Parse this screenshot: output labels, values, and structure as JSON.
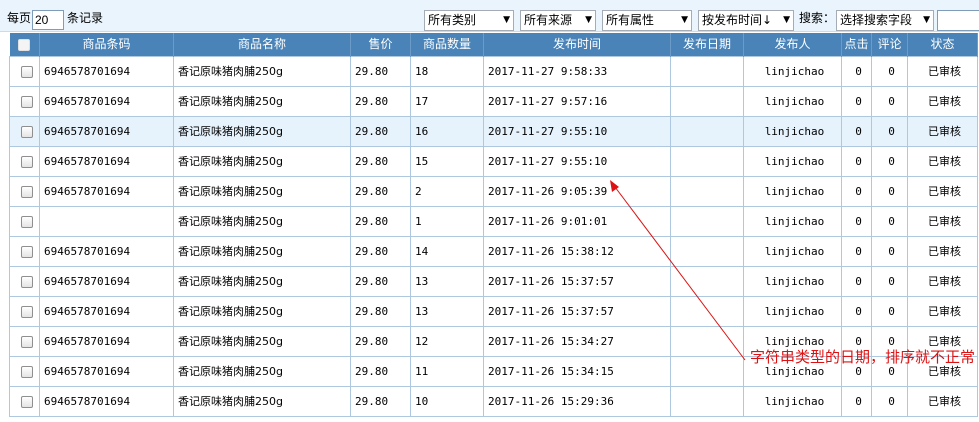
{
  "toolbar": {
    "per_page_label": "每页",
    "per_page_value": "20",
    "records_label": "条记录",
    "filters": [
      {
        "label": "所有类别"
      },
      {
        "label": "所有来源"
      },
      {
        "label": "所有属性"
      },
      {
        "label": "按发布时间↓"
      }
    ],
    "search_label": "搜索：",
    "search_field_select": "选择搜索字段"
  },
  "table": {
    "headers": {
      "barcode": "商品条码",
      "name": "商品名称",
      "price": "售价",
      "quantity": "商品数量",
      "publish_time": "发布时间",
      "publish_date": "发布日期",
      "publisher": "发布人",
      "clicks": "点击",
      "comments": "评论",
      "status": "状态"
    },
    "rows": [
      {
        "barcode": "6946578701694",
        "name": "香记原味猪肉脯250g",
        "price": "29.80",
        "quantity": "18",
        "publish_time": "2017-11-27 9:58:33",
        "publish_date": "",
        "publisher": "linjichao",
        "clicks": "0",
        "comments": "0",
        "status": "已审核"
      },
      {
        "barcode": "6946578701694",
        "name": "香记原味猪肉脯250g",
        "price": "29.80",
        "quantity": "17",
        "publish_time": "2017-11-27 9:57:16",
        "publish_date": "",
        "publisher": "linjichao",
        "clicks": "0",
        "comments": "0",
        "status": "已审核"
      },
      {
        "barcode": "6946578701694",
        "name": "香记原味猪肉脯250g",
        "price": "29.80",
        "quantity": "16",
        "publish_time": "2017-11-27 9:55:10",
        "publish_date": "",
        "publisher": "linjichao",
        "clicks": "0",
        "comments": "0",
        "status": "已审核"
      },
      {
        "barcode": "6946578701694",
        "name": "香记原味猪肉脯250g",
        "price": "29.80",
        "quantity": "15",
        "publish_time": "2017-11-27 9:55:10",
        "publish_date": "",
        "publisher": "linjichao",
        "clicks": "0",
        "comments": "0",
        "status": "已审核"
      },
      {
        "barcode": "6946578701694",
        "name": "香记原味猪肉脯250g",
        "price": "29.80",
        "quantity": "2",
        "publish_time": "2017-11-26 9:05:39",
        "publish_date": "",
        "publisher": "linjichao",
        "clicks": "0",
        "comments": "0",
        "status": "已审核"
      },
      {
        "barcode": "",
        "name": "香记原味猪肉脯250g",
        "price": "29.80",
        "quantity": "1",
        "publish_time": "2017-11-26 9:01:01",
        "publish_date": "",
        "publisher": "linjichao",
        "clicks": "0",
        "comments": "0",
        "status": "已审核"
      },
      {
        "barcode": "6946578701694",
        "name": "香记原味猪肉脯250g",
        "price": "29.80",
        "quantity": "14",
        "publish_time": "2017-11-26 15:38:12",
        "publish_date": "",
        "publisher": "linjichao",
        "clicks": "0",
        "comments": "0",
        "status": "已审核"
      },
      {
        "barcode": "6946578701694",
        "name": "香记原味猪肉脯250g",
        "price": "29.80",
        "quantity": "13",
        "publish_time": "2017-11-26 15:37:57",
        "publish_date": "",
        "publisher": "linjichao",
        "clicks": "0",
        "comments": "0",
        "status": "已审核"
      },
      {
        "barcode": "6946578701694",
        "name": "香记原味猪肉脯250g",
        "price": "29.80",
        "quantity": "13",
        "publish_time": "2017-11-26 15:37:57",
        "publish_date": "",
        "publisher": "linjichao",
        "clicks": "0",
        "comments": "0",
        "status": "已审核"
      },
      {
        "barcode": "6946578701694",
        "name": "香记原味猪肉脯250g",
        "price": "29.80",
        "quantity": "12",
        "publish_time": "2017-11-26 15:34:27",
        "publish_date": "",
        "publisher": "linjichao",
        "clicks": "0",
        "comments": "0",
        "status": "已审核"
      },
      {
        "barcode": "6946578701694",
        "name": "香记原味猪肉脯250g",
        "price": "29.80",
        "quantity": "11",
        "publish_time": "2017-11-26 15:34:15",
        "publish_date": "",
        "publisher": "linjichao",
        "clicks": "0",
        "comments": "0",
        "status": "已审核"
      },
      {
        "barcode": "6946578701694",
        "name": "香记原味猪肉脯250g",
        "price": "29.80",
        "quantity": "10",
        "publish_time": "2017-11-26 15:29:36",
        "publish_date": "",
        "publisher": "linjichao",
        "clicks": "0",
        "comments": "0",
        "status": "已审核"
      }
    ]
  },
  "annotation": {
    "text": "字符串类型的日期，排序就不正常",
    "color": "#dd1111"
  },
  "colors": {
    "header_bg": "#4983b8",
    "toolbar_bg": "#eaf4fc",
    "highlight_row": "#e6f2fc"
  }
}
